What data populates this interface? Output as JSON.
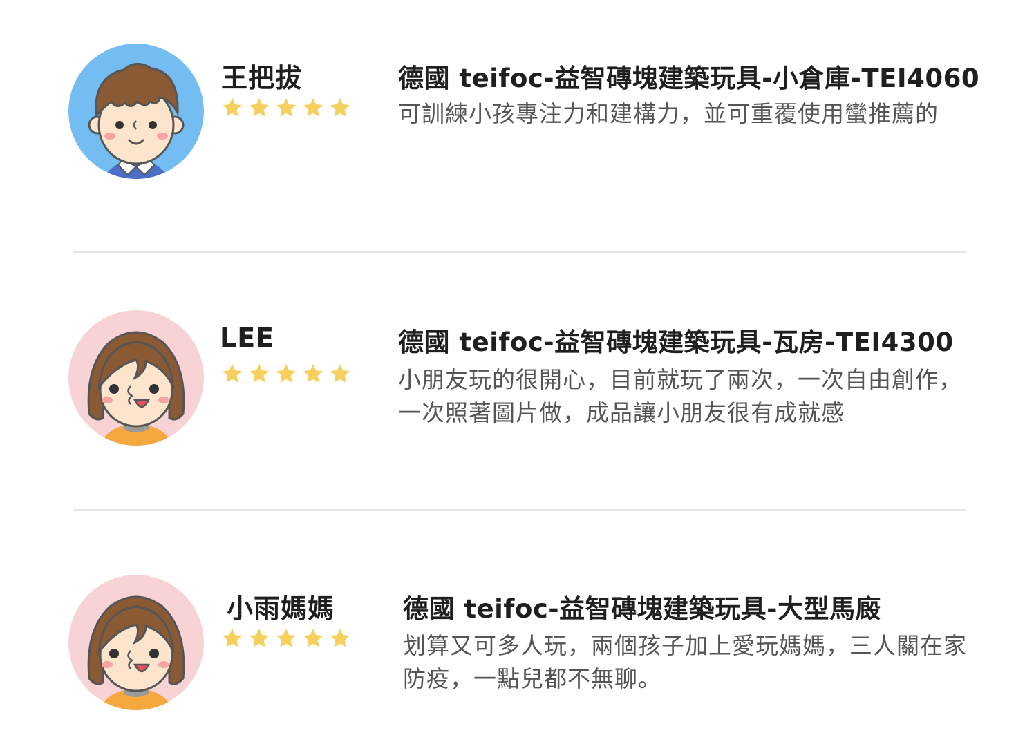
{
  "reviews": [
    {
      "name": "王把拔",
      "rating": 5,
      "product_title": "德國 teifoc-益智磚塊建築玩具-小倉庫-TEI4060",
      "comment": "可訓練小孩專注力和建構力，並可重覆使用蠻推薦的",
      "avatar": "boy-avatar-icon"
    },
    {
      "name": "LEE",
      "rating": 5,
      "product_title": "德國 teifoc-益智磚塊建築玩具-瓦房-TEI4300",
      "comment": "小朋友玩的很開心，目前就玩了兩次，一次自由創作，一次照著圖片做，成品讓小朋友很有成就感",
      "avatar": "girl-avatar-icon"
    },
    {
      "name": "小雨媽媽",
      "rating": 5,
      "product_title": "德國 teifoc-益智磚塊建築玩具-大型馬廄",
      "comment": "划算又可多人玩，兩個孩子加上愛玩媽媽，三人關在家防疫，一點兒都不無聊。",
      "avatar": "girl-avatar-icon"
    }
  ],
  "colors": {
    "star": "#f7cf5c",
    "boy_avatar_bg": "#74bdf2",
    "girl_avatar_bg": "#f8d3d6",
    "hair": "#8a5a34",
    "skin": "#fde4cc",
    "divider": "#e6e6e6"
  }
}
